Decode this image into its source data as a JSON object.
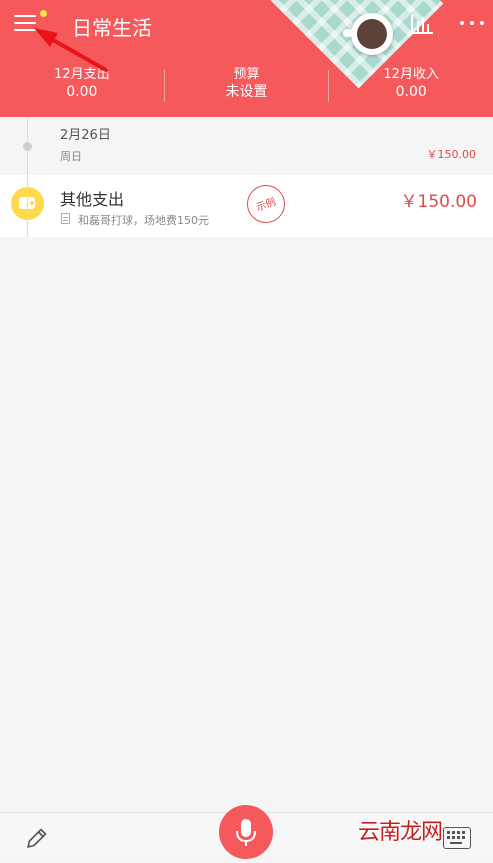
{
  "header": {
    "title": "日常生活",
    "stats": [
      {
        "label": "12月支出",
        "value": "0.00"
      },
      {
        "label": "预算",
        "value": "未设置"
      },
      {
        "label": "12月收入",
        "value": "0.00"
      }
    ]
  },
  "records": {
    "day": {
      "date": "2月26日",
      "weekday": "周日",
      "total": "￥150.00"
    },
    "item": {
      "category": "其他支出",
      "note": "和磊哥打球，场地费150元",
      "stamp": "示例",
      "amount": "￥150.00"
    }
  },
  "watermark": "云南龙网",
  "colors": {
    "accent": "#f5595c",
    "amount": "#e3474a",
    "category": "#ffd84d",
    "arrow": "#e8121a"
  },
  "icons": [
    "menu-icon",
    "notification-dot-icon",
    "coffee-cup-icon",
    "bar-chart-icon",
    "more-icon",
    "wallet-icon",
    "note-icon",
    "pencil-icon",
    "microphone-icon",
    "keyboard-icon"
  ]
}
